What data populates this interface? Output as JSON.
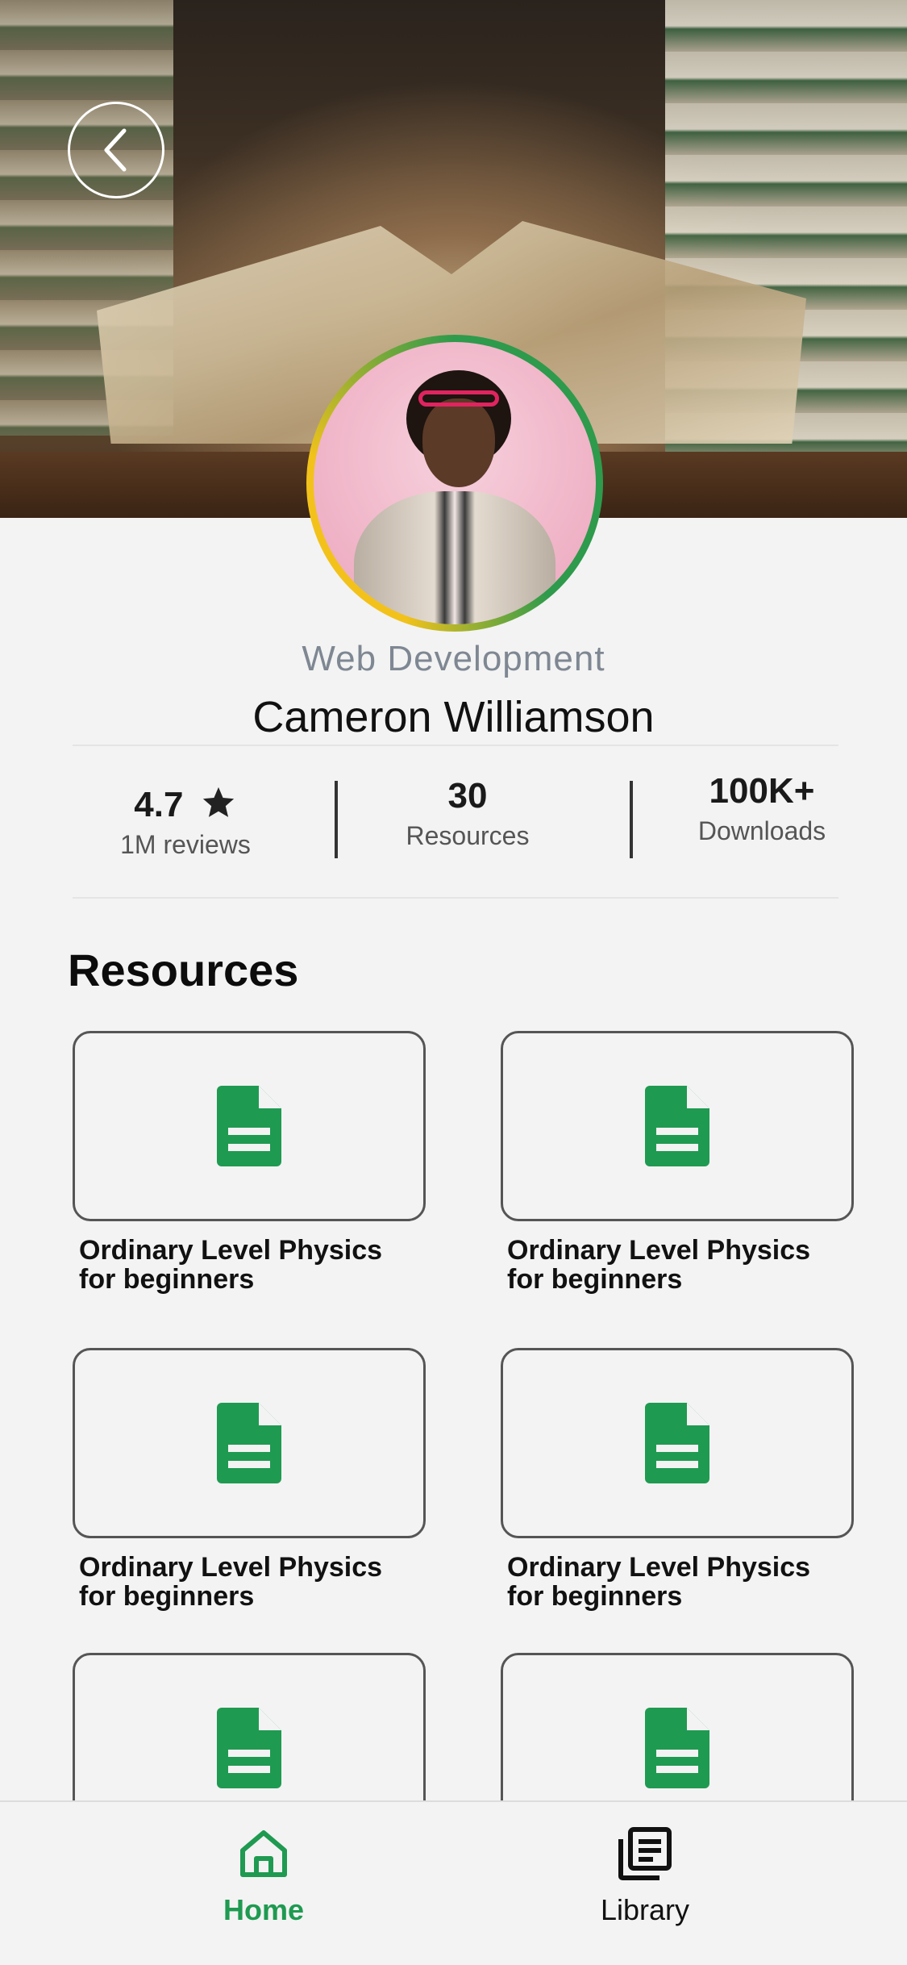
{
  "header": {
    "back_icon": "chevron-left-icon"
  },
  "profile": {
    "subtitle": "Web Development",
    "name": "Cameron Williamson"
  },
  "stats": {
    "rating": {
      "value": "4.7",
      "icon": "star-icon",
      "label": "1M reviews"
    },
    "resources": {
      "value": "30",
      "label": "Resources"
    },
    "downloads": {
      "value": "100K+",
      "label": "Downloads"
    }
  },
  "resources_section": {
    "title": "Resources",
    "items": [
      {
        "title_line1": "Ordinary Level Physics",
        "title_line2": "for beginners",
        "icon": "document-icon"
      },
      {
        "title_line1": "Ordinary Level Physics",
        "title_line2": "for beginners",
        "icon": "document-icon"
      },
      {
        "title_line1": "Ordinary Level Physics",
        "title_line2": "for beginners",
        "icon": "document-icon"
      },
      {
        "title_line1": "Ordinary Level Physics",
        "title_line2": "for beginners",
        "icon": "document-icon"
      },
      {
        "title_line1": "",
        "title_line2": "",
        "icon": "document-icon"
      },
      {
        "title_line1": "",
        "title_line2": "",
        "icon": "document-icon"
      }
    ]
  },
  "bottom_nav": {
    "items": [
      {
        "label": "Home",
        "icon": "home-icon",
        "active": true
      },
      {
        "label": "Library",
        "icon": "library-icon",
        "active": false
      }
    ]
  },
  "colors": {
    "accent_green": "#1f9a51",
    "ring_yellow": "#f2c21b",
    "muted_text": "#7e8792"
  }
}
